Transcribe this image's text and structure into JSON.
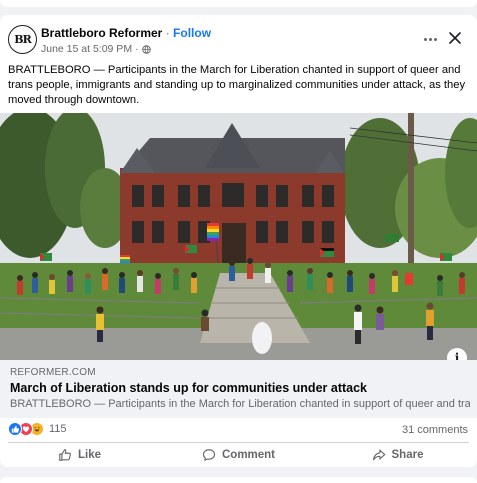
{
  "post": {
    "page_name": "Brattleboro Reformer",
    "separator": "·",
    "follow_label": "Follow",
    "timestamp": "June 15 at 5:09 PM",
    "meta_dot": "·",
    "avatar_initials": "BR",
    "body": "BRATTLEBORO — Participants in the March for Liberation chanted in support of queer and trans people, immigrants and standing up to marginalized communities under attack, as they moved through downtown.",
    "info_label": "i"
  },
  "link": {
    "domain": "REFORMER.COM",
    "title": "March of Liberation stands up for communities under attack",
    "description": "BRATTLEBORO — Participants in the March for Liberation chanted in support of queer and tra..."
  },
  "stats": {
    "reaction_count": "115",
    "comments": "31 comments",
    "reaction_icons": [
      "like-icon",
      "love-icon",
      "haha-icon"
    ]
  },
  "actions": {
    "like": "Like",
    "comment": "Comment",
    "share": "Share"
  },
  "colors": {
    "facebook_blue": "#1877f2",
    "like_blue": "#1877f2",
    "love_red": "#f33e58",
    "haha_yellow": "#f7b125",
    "muted_text": "#65676b",
    "background": "#f0f2f5"
  }
}
